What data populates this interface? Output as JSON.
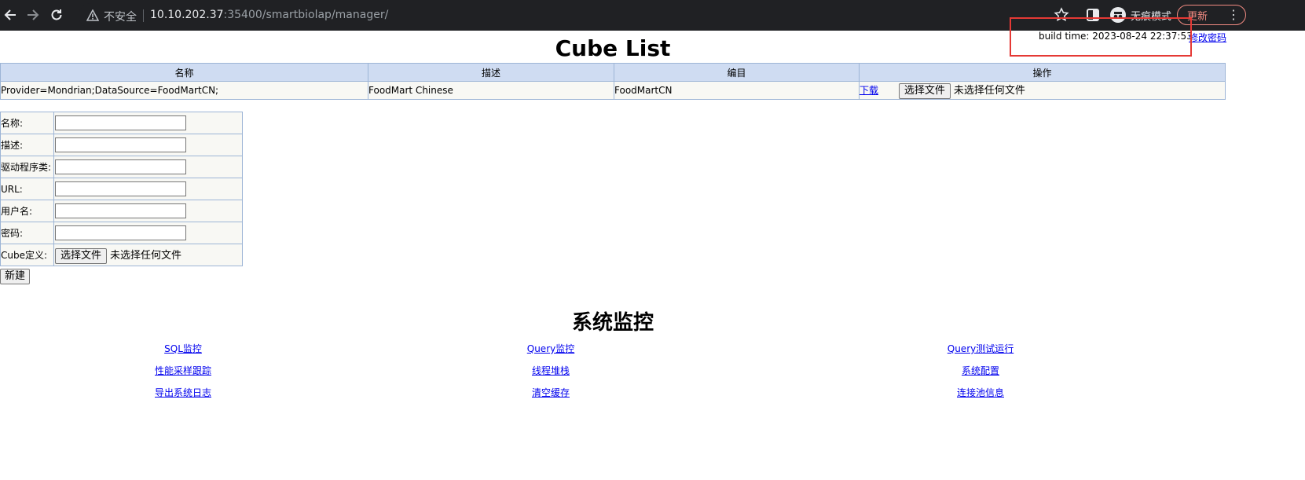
{
  "browser": {
    "insecure_label": "不安全",
    "url_host": "10.10.202.37",
    "url_rest": ":35400/smartbiolap/manager/",
    "incognito_label": "无痕模式",
    "update_label": "更新"
  },
  "header": {
    "build_time": "build time: 2023-08-24 22:37:53",
    "change_password": "修改密码"
  },
  "cube_list": {
    "title": "Cube List",
    "columns": [
      "名称",
      "描述",
      "编目",
      "操作"
    ],
    "rows": [
      {
        "name": "Provider=Mondrian;DataSource=FoodMartCN;",
        "description": "FoodMart Chinese",
        "catalog": "FoodMartCN",
        "download_label": "下载",
        "choose_file_label": "选择文件",
        "no_file_label": "未选择任何文件"
      }
    ]
  },
  "form": {
    "name_label": "名称:",
    "desc_label": "描述:",
    "driver_label": "驱动程序类:",
    "url_label": "URL:",
    "user_label": "用户名:",
    "password_label": "密码:",
    "cube_def_label": "Cube定义:",
    "choose_file_label": "选择文件",
    "no_file_label": "未选择任何文件",
    "create_label": "新建"
  },
  "monitor": {
    "title": "系统监控",
    "links": {
      "sql_monitor": "SQL监控",
      "query_monitor": "Query监控",
      "query_test_run": "Query测试运行",
      "perf_sampling": "性能采样跟踪",
      "thread_stack": "线程堆栈",
      "system_config": "系统配置",
      "export_log": "导出系统日志",
      "clear_cache": "清空缓存",
      "pool_info": "连接池信息"
    }
  }
}
